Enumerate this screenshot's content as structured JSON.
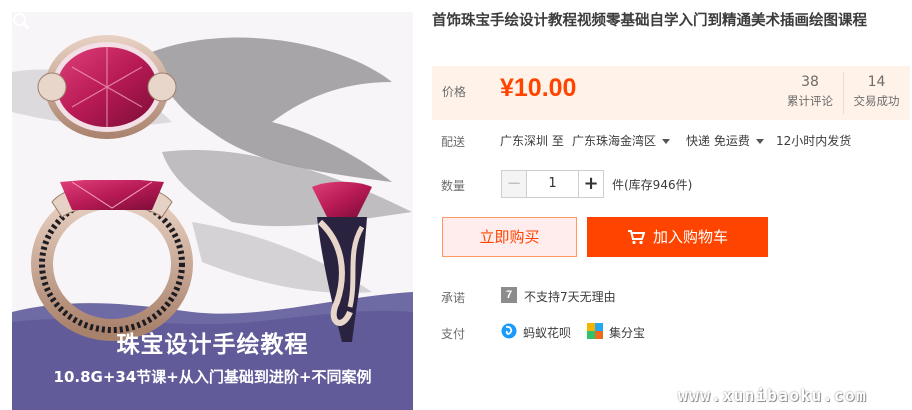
{
  "product_image": {
    "title": "珠宝设计手绘教程",
    "subtitle": "10.8G+34节课+从入门基础到进阶+不同案例"
  },
  "title": "首饰珠宝手绘设计教程视频零基础自学入门到精通美术插画绘图课程",
  "price": {
    "label": "价格",
    "value": "¥10.00",
    "reviews_count": "38",
    "reviews_label": "累计评论",
    "sales_count": "14",
    "sales_label": "交易成功"
  },
  "shipping": {
    "label": "配送",
    "from": "广东深圳 至",
    "to": "广东珠海金湾区",
    "method": "快递 免运费",
    "dispatch": "12小时内发货"
  },
  "quantity": {
    "label": "数量",
    "minus": "−",
    "value": "1",
    "plus": "+",
    "stock": "件(库存946件)"
  },
  "actions": {
    "buy_now": "立即购买",
    "add_cart": "加入购物车"
  },
  "promise": {
    "label": "承诺",
    "icon_text": "7",
    "text": "不支持7天无理由"
  },
  "payment": {
    "label": "支付",
    "methods": [
      "蚂蚁花呗",
      "集分宝"
    ]
  },
  "watermark": "www.xunibaoku.com",
  "colors": {
    "accent": "#ff4400",
    "price_bg": "#fff2e8",
    "buy_now_bg": "#ffeded"
  }
}
